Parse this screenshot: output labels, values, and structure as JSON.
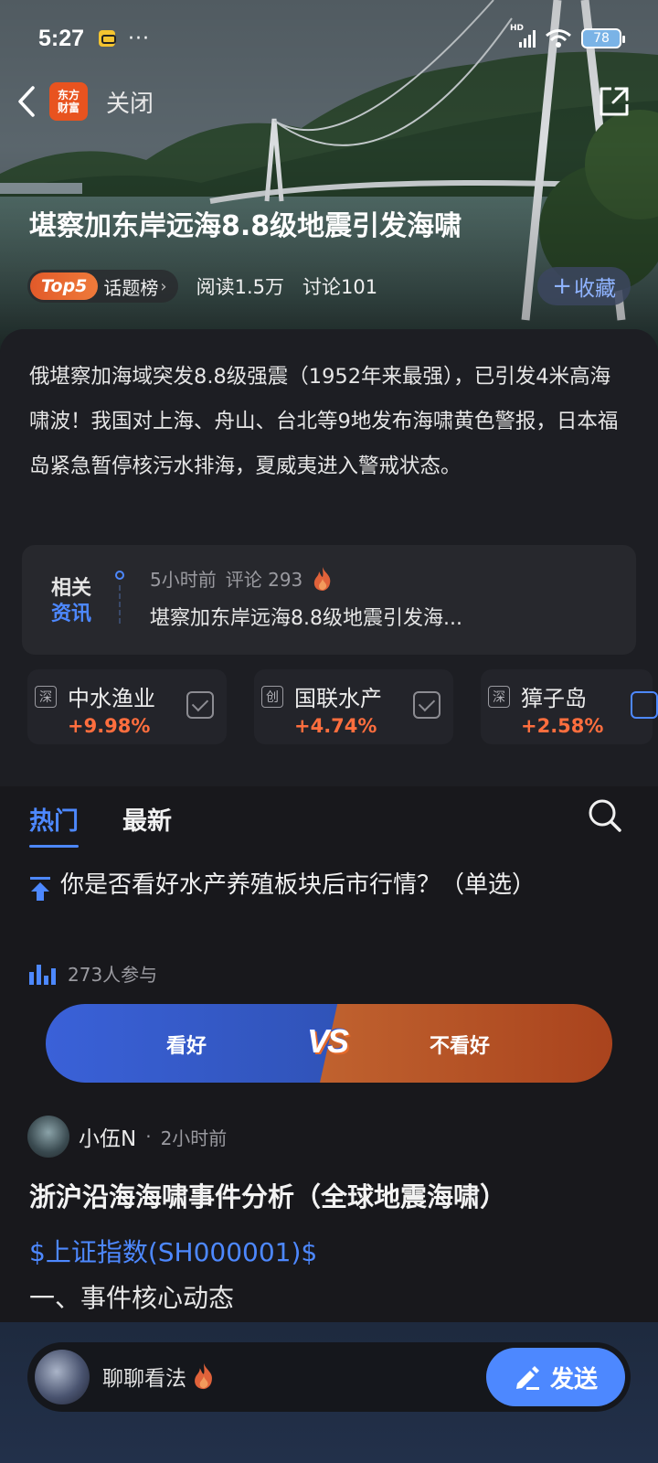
{
  "status_bar": {
    "time": "5:27",
    "more": "···",
    "network": "HD",
    "battery": "78"
  },
  "nav": {
    "logo_line1": "东方",
    "logo_line2": "财富",
    "close_label": "关闭"
  },
  "topic": {
    "title": "堪察加东岸远海8.8级地震引发海啸",
    "rank_badge": "Top5",
    "rank_label": "话题榜",
    "reads": "阅读1.5万",
    "discussions": "讨论101",
    "collect_label": "收藏"
  },
  "description": "俄堪察加海域突发8.8级强震（1952年来最强），已引发4米高海啸波！我国对上海、舟山、台北等9地发布海啸黄色警报，日本福岛紧急暂停核污水排海，夏威夷进入警戒状态。",
  "related_news": {
    "tag_line1": "相关",
    "tag_line2": "资讯",
    "time": "5小时前",
    "comments": "评论 293",
    "headline": "堪察加东岸远海8.8级地震引发海..."
  },
  "stocks": [
    {
      "market": "深",
      "name": "中水渔业",
      "change": "+9.98%"
    },
    {
      "market": "创",
      "name": "国联水产",
      "change": "+4.74%"
    },
    {
      "market": "深",
      "name": "獐子岛",
      "change": "+2.58%"
    }
  ],
  "tabs": {
    "hot": "热门",
    "latest": "最新"
  },
  "poll": {
    "question": "你是否看好水产养殖板块后市行情？（单选）",
    "participants": "273人参与",
    "option_yes": "看好",
    "vs": "VS",
    "option_no": "不看好"
  },
  "post": {
    "author": "小伍N",
    "time": "2小时前",
    "title": "浙沪沿海海啸事件分析（全球地震海啸）",
    "stock_link": "$上证指数(SH000001)$",
    "section": "一、事件核心动态"
  },
  "composer": {
    "placeholder": "聊聊看法",
    "send_label": "发送"
  },
  "colors": {
    "accent": "#4d88ff",
    "up": "#ff6e3e",
    "brand": "#e8531f"
  }
}
